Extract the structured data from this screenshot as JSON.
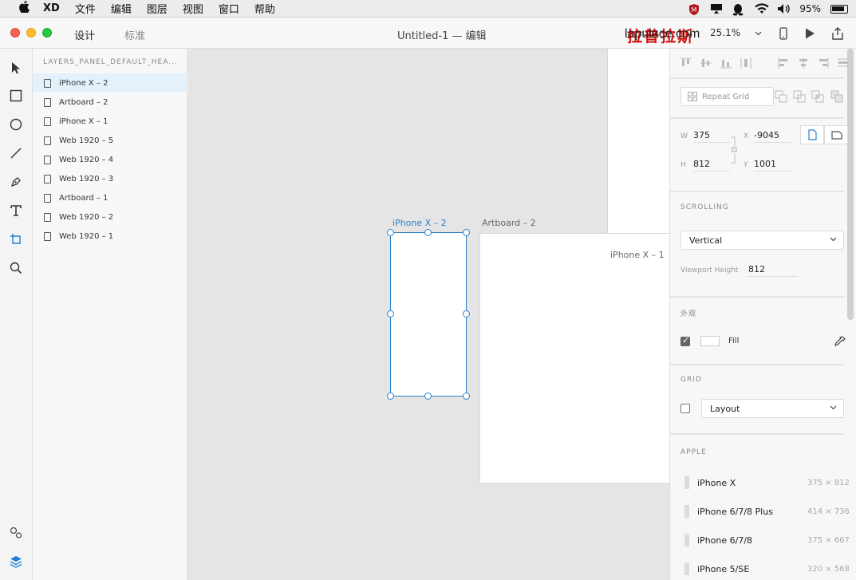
{
  "menubar": {
    "app": "XD",
    "items": [
      "文件",
      "编辑",
      "图层",
      "视图",
      "窗口",
      "帮助"
    ],
    "battery": "95%"
  },
  "titlebar": {
    "tabs": [
      {
        "label": "设计",
        "active": true
      },
      {
        "label": "标准",
        "active": false
      }
    ],
    "document_title": "Untitled-1 — 编辑",
    "zoom": "25.1%",
    "watermark_cn": "拉普拉斯",
    "watermark_en": "lapulace.com"
  },
  "layers": {
    "header": "LAYERS_PANEL_DEFAULT_HEA...",
    "items": [
      {
        "label": "iPhone X – 2",
        "selected": true
      },
      {
        "label": "Artboard – 2",
        "selected": false
      },
      {
        "label": "iPhone X – 1",
        "selected": false
      },
      {
        "label": "Web 1920 – 5",
        "selected": false
      },
      {
        "label": "Web 1920 – 4",
        "selected": false
      },
      {
        "label": "Web 1920 – 3",
        "selected": false
      },
      {
        "label": "Artboard – 1",
        "selected": false
      },
      {
        "label": "Web 1920 – 2",
        "selected": false
      },
      {
        "label": "Web 1920 – 1",
        "selected": false
      }
    ]
  },
  "canvas": {
    "selected_label": "iPhone X – 2",
    "artboard2_label": "Artboard – 2",
    "iphone1_label": "iPhone X – 1"
  },
  "inspector": {
    "repeat_grid": "Repeat Grid",
    "w_label": "W",
    "w_value": "375",
    "x_label": "X",
    "x_value": "-9045",
    "h_label": "H",
    "h_value": "812",
    "y_label": "Y",
    "y_value": "1001",
    "scrolling_title": "SCROLLING",
    "scrolling_value": "Vertical",
    "viewport_label": "Viewport Height",
    "viewport_value": "812",
    "appearance_title": "外观",
    "fill_label": "Fill",
    "fill_checked": true,
    "fill_color": "#ffffff",
    "grid_title": "GRID",
    "grid_checked": false,
    "grid_value": "Layout",
    "apple_title": "APPLE",
    "devices": [
      {
        "name": "iPhone X",
        "size": "375 × 812"
      },
      {
        "name": "iPhone 6/7/8 Plus",
        "size": "414 × 736"
      },
      {
        "name": "iPhone 6/7/8",
        "size": "375 × 667"
      },
      {
        "name": "iPhone 5/SE",
        "size": "320 × 568"
      }
    ]
  },
  "colors": {
    "selection_blue": "#2b80c9",
    "layers_accent": "#1e7fd6"
  }
}
